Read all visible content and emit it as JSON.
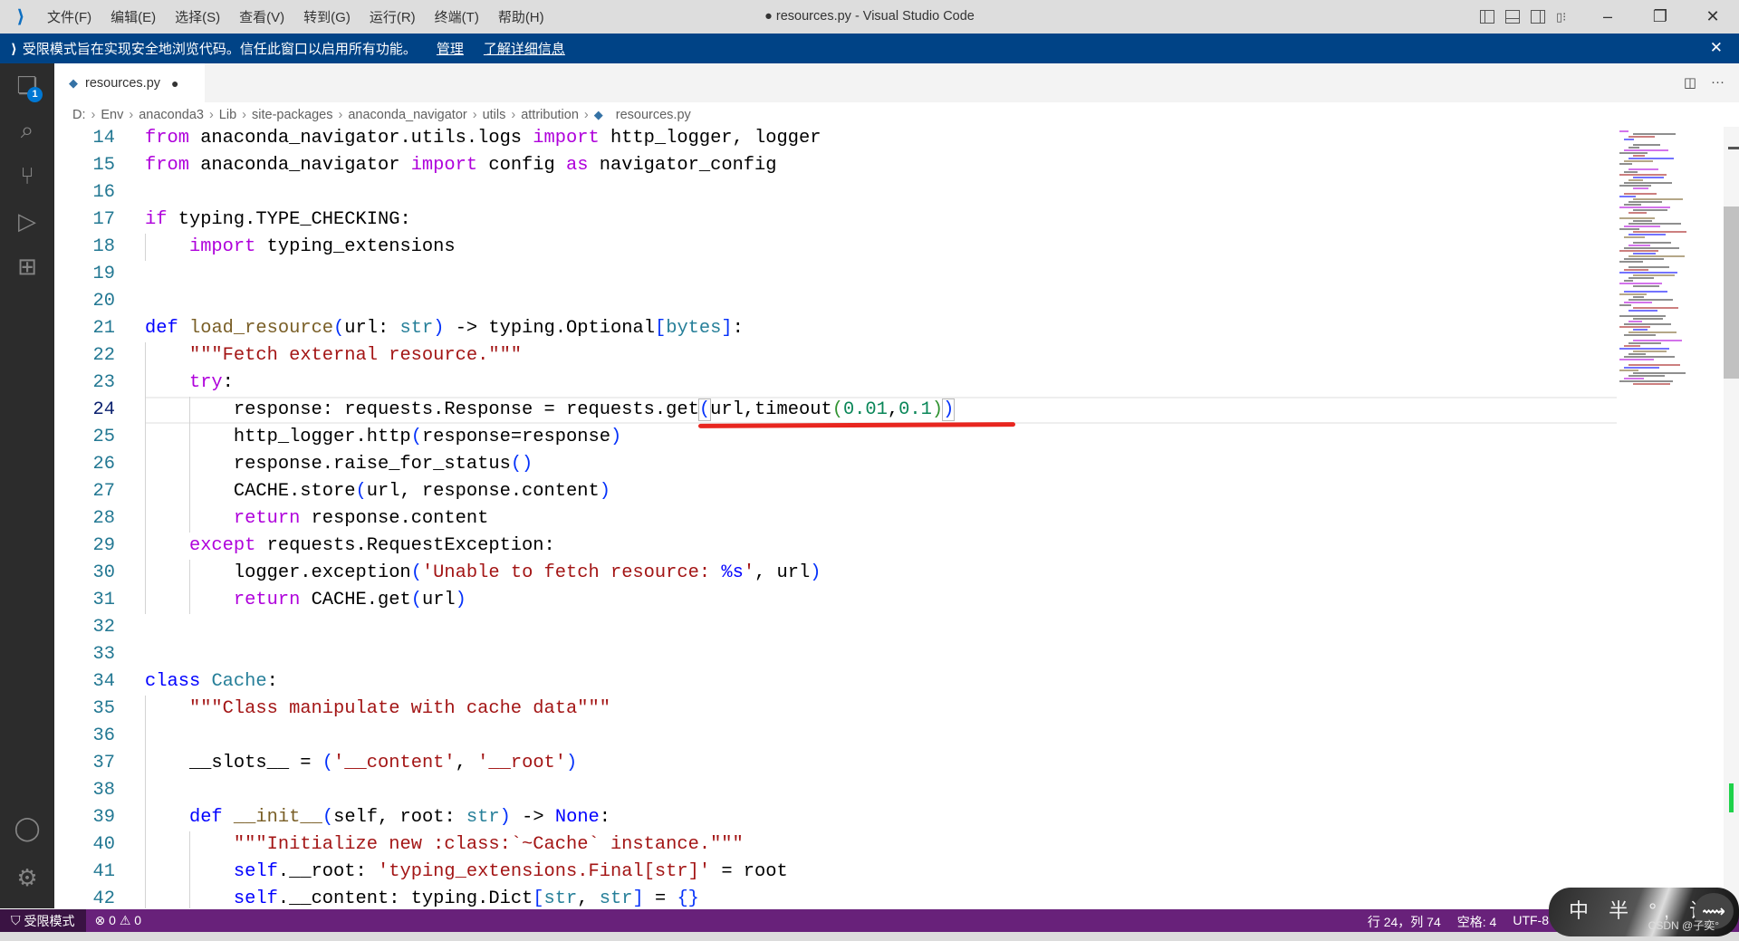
{
  "window": {
    "title": "● resources.py - Visual Studio Code",
    "menu": [
      "文件(F)",
      "编辑(E)",
      "选择(S)",
      "查看(V)",
      "转到(G)",
      "运行(R)",
      "终端(T)",
      "帮助(H)"
    ]
  },
  "banner": {
    "message": "受限模式旨在实现安全地浏览代码。信任此窗口以启用所有功能。",
    "manage": "管理",
    "learn_more": "了解详细信息"
  },
  "activity_bar": {
    "items": [
      "explorer-icon",
      "search-icon",
      "source-control-icon",
      "run-debug-icon",
      "extensions-icon"
    ],
    "explorer_badge": "1",
    "bottom": [
      "account-icon",
      "settings-gear-icon"
    ]
  },
  "tab": {
    "label": "resources.py",
    "modified": "●"
  },
  "breadcrumb": [
    "D:",
    "Env",
    "anaconda3",
    "Lib",
    "site-packages",
    "anaconda_navigator",
    "utils",
    "attribution",
    "resources.py"
  ],
  "editor": {
    "current_line": 24,
    "lines": [
      {
        "n": 14,
        "t": [
          [
            "from",
            "kw"
          ],
          " anaconda_navigator.utils.logs ",
          [
            "import",
            "kw"
          ],
          " http_logger, logger"
        ]
      },
      {
        "n": 15,
        "t": [
          [
            "from",
            "kw"
          ],
          " anaconda_navigator ",
          [
            "import",
            "kw"
          ],
          " config ",
          [
            "as",
            "kw"
          ],
          " navigator_config"
        ]
      },
      {
        "n": 16,
        "t": []
      },
      {
        "n": 17,
        "t": [
          [
            "if",
            "kw"
          ],
          " typing.TYPE_CHECKING:"
        ]
      },
      {
        "n": 18,
        "t": [
          "    ",
          [
            "import",
            "kw"
          ],
          " typing_extensions"
        ]
      },
      {
        "n": 19,
        "t": []
      },
      {
        "n": 20,
        "t": []
      },
      {
        "n": 21,
        "t": [
          [
            "def",
            "kd"
          ],
          " ",
          [
            "load_resource",
            "fn"
          ],
          [
            "(",
            "p1"
          ],
          "url: ",
          [
            "str",
            "ty"
          ],
          [
            ")",
            "p1"
          ],
          " -> typing.Optional",
          [
            "[",
            "p1"
          ],
          [
            "bytes",
            "ty"
          ],
          [
            "]",
            "p1"
          ],
          ":"
        ]
      },
      {
        "n": 22,
        "t": [
          "    ",
          [
            "\"\"\"Fetch external resource.\"\"\"",
            "str"
          ]
        ]
      },
      {
        "n": 23,
        "t": [
          "    ",
          [
            "try",
            "kw"
          ],
          ":"
        ]
      },
      {
        "n": 24,
        "t": [
          "        response: requests.Response = requests.get",
          [
            "(",
            "p1 bmatch"
          ],
          "url,timeout",
          [
            "(",
            "p2"
          ],
          [
            "0.01",
            "num"
          ],
          ",",
          [
            "0.1",
            "num"
          ],
          [
            ")",
            "p2"
          ],
          [
            ")",
            "p1 bmatch"
          ]
        ]
      },
      {
        "n": 25,
        "t": [
          "        http_logger.http",
          [
            "(",
            "p1"
          ],
          "response=response",
          [
            ")",
            "p1"
          ]
        ]
      },
      {
        "n": 26,
        "t": [
          "        response.raise_for_status",
          [
            "()",
            "p1"
          ]
        ]
      },
      {
        "n": 27,
        "t": [
          "        CACHE.store",
          [
            "(",
            "p1"
          ],
          "url, response.content",
          [
            ")",
            "p1"
          ]
        ]
      },
      {
        "n": 28,
        "t": [
          "        ",
          [
            "return",
            "kw"
          ],
          " response.content"
        ]
      },
      {
        "n": 29,
        "t": [
          "    ",
          [
            "except",
            "kw"
          ],
          " requests.RequestException:"
        ]
      },
      {
        "n": 30,
        "t": [
          "        logger.exception",
          [
            "(",
            "p1"
          ],
          [
            "'Unable to fetch resource: ",
            "str"
          ],
          [
            "%s",
            "kd"
          ],
          [
            "'",
            "str"
          ],
          ", url",
          [
            ")",
            "p1"
          ]
        ]
      },
      {
        "n": 31,
        "t": [
          "        ",
          [
            "return",
            "kw"
          ],
          " CACHE.get",
          [
            "(",
            "p1"
          ],
          "url",
          [
            ")",
            "p1"
          ]
        ]
      },
      {
        "n": 32,
        "t": []
      },
      {
        "n": 33,
        "t": []
      },
      {
        "n": 34,
        "t": [
          [
            "class",
            "kd"
          ],
          " ",
          [
            "Cache",
            "ty"
          ],
          ":"
        ]
      },
      {
        "n": 35,
        "t": [
          "    ",
          [
            "\"\"\"Class manipulate with cache data\"\"\"",
            "str"
          ]
        ]
      },
      {
        "n": 36,
        "t": []
      },
      {
        "n": 37,
        "t": [
          "    __slots__ = ",
          [
            "(",
            "p1"
          ],
          [
            "'__content'",
            "str"
          ],
          ", ",
          [
            "'__root'",
            "str"
          ],
          [
            ")",
            "p1"
          ]
        ]
      },
      {
        "n": 38,
        "t": []
      },
      {
        "n": 39,
        "t": [
          "    ",
          [
            "def",
            "kd"
          ],
          " ",
          [
            "__init__",
            "fn"
          ],
          [
            "(",
            "p1"
          ],
          "self, root: ",
          [
            "str",
            "ty"
          ],
          [
            ")",
            "p1"
          ],
          " -> ",
          [
            "None",
            "kd"
          ],
          ":"
        ]
      },
      {
        "n": 40,
        "t": [
          "        ",
          [
            "\"\"\"Initialize new :class:`~Cache` instance.\"\"\"",
            "str"
          ]
        ]
      },
      {
        "n": 41,
        "t": [
          "        ",
          [
            "self",
            "kd"
          ],
          ".__root: ",
          [
            "'typing_extensions.Final[str]'",
            "str"
          ],
          " = root"
        ]
      },
      {
        "n": 42,
        "t": [
          "        ",
          [
            "self",
            "kd"
          ],
          ".__content: typing.Dict",
          [
            "[",
            "p1"
          ],
          [
            "str",
            "ty"
          ],
          ", ",
          [
            "str",
            "ty"
          ],
          [
            "]",
            "p1"
          ],
          " = ",
          [
            "{}",
            "p1"
          ]
        ]
      }
    ]
  },
  "statusbar": {
    "restricted": "受限模式",
    "errors": "0",
    "warnings": "0",
    "position": "行 24，列 74",
    "spaces": "空格: 4",
    "encoding": "UTF-8"
  },
  "ime": {
    "chars": "中 半 °, 设",
    "watermark": "CSDN @子奕°"
  },
  "colors": {
    "accent_banner": "#004386",
    "statusbar": "#68217a",
    "annotation_underline": "#e8261f"
  }
}
